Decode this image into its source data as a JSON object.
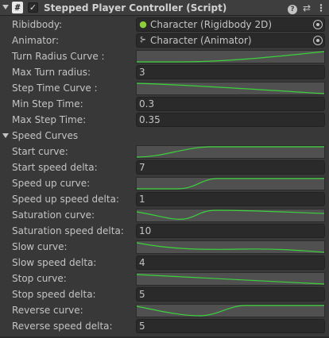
{
  "header": {
    "title": "Stepped Player Controller (Script)",
    "script_icon_glyph": "#",
    "enabled": true,
    "icons": [
      "help-icon",
      "preset-icon",
      "kebab-menu-icon"
    ]
  },
  "fields": {
    "rigidbody": {
      "label": "Ribidbody:",
      "value": "Character (Rigidbody 2D)",
      "icon": "rigidbody-2d-icon"
    },
    "animator": {
      "label": "Animator:",
      "value": "Character (Animator)",
      "icon": "animator-icon"
    },
    "turn_radius_curve": {
      "label": "Turn Radius Curve :"
    },
    "max_turn_radius": {
      "label": "Max Turn radius:",
      "value": "3"
    },
    "step_time_curve": {
      "label": "Step Time  Curve :"
    },
    "min_step_time": {
      "label": "Min Step Time:",
      "value": "0.3"
    },
    "max_step_time": {
      "label": "Max Step Time:",
      "value": "0.35"
    }
  },
  "speed_curves": {
    "label": "Speed Curves",
    "expanded": true,
    "start_curve": {
      "label": "Start curve:"
    },
    "start_speed_delta": {
      "label": "Start speed delta:",
      "value": "7"
    },
    "speed_up_curve": {
      "label": "Speed up curve:"
    },
    "speed_up_speed_delta": {
      "label": "Speed up speed delta:",
      "value": "1"
    },
    "saturation_curve": {
      "label": "Saturation curve:"
    },
    "saturation_speed_delta": {
      "label": "Saturation speed delta:",
      "value": "10"
    },
    "slow_curve": {
      "label": "Slow curve:"
    },
    "slow_speed_delta": {
      "label": "Slow speed delta:",
      "value": "4"
    },
    "stop_curve": {
      "label": "Stop curve:"
    },
    "stop_speed_delta": {
      "label": "Stop speed delta:",
      "value": "5"
    },
    "reverse_curve": {
      "label": "Reverse curve:"
    },
    "reverse_speed_delta": {
      "label": "Reverse speed delta:",
      "value": "5"
    }
  },
  "colors": {
    "background": "#383838",
    "field_background": "#2a2a2a",
    "curve_background": "#505050",
    "curve_line": "#3cd23c",
    "text": "#c4c4c4"
  }
}
